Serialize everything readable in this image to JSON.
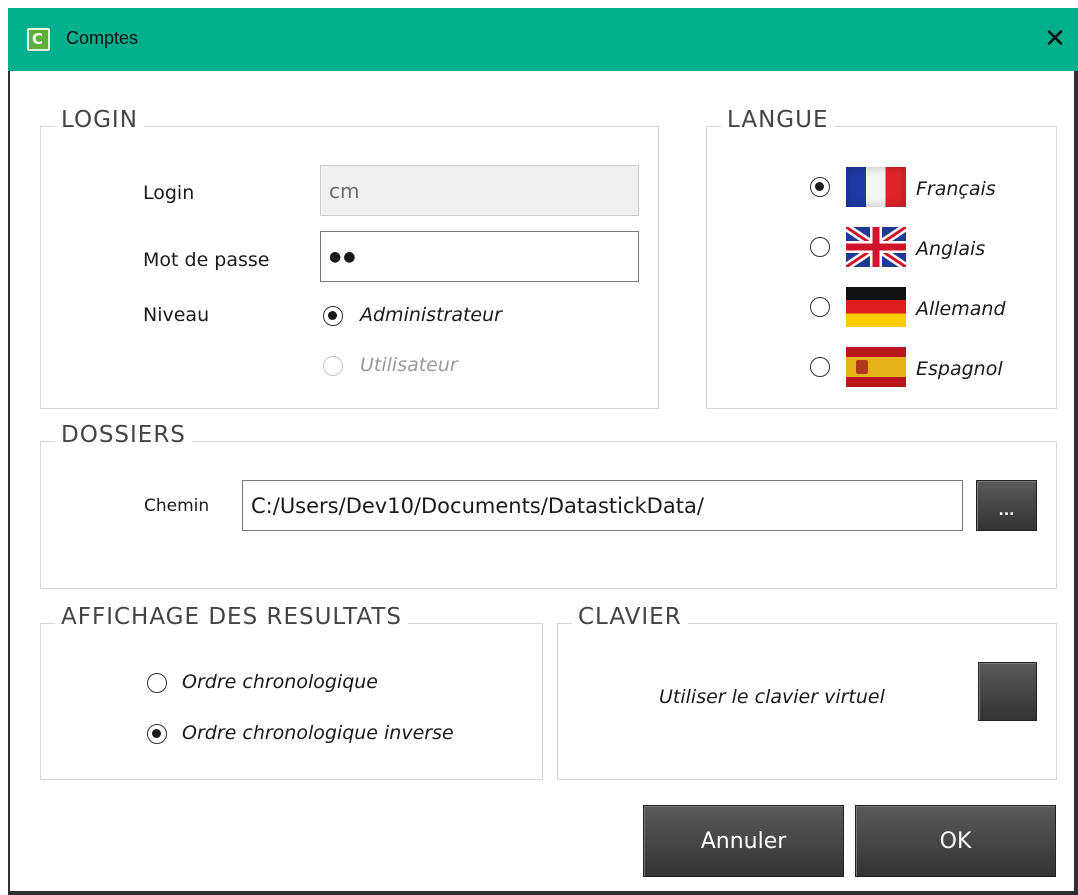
{
  "window": {
    "title": "Comptes",
    "icon": "app-logo-icon",
    "close_glyph": "✕"
  },
  "login": {
    "section_title": "LOGIN",
    "login_label": "Login",
    "login_value": "cm",
    "password_label": "Mot de passe",
    "password_value": "●●",
    "level_label": "Niveau",
    "level_options": [
      {
        "label": "Administrateur",
        "checked": true,
        "enabled": true
      },
      {
        "label": "Utilisateur",
        "checked": false,
        "enabled": false
      }
    ]
  },
  "language": {
    "section_title": "LANGUE",
    "options": [
      {
        "label": "Français",
        "flag": "flag-france-icon",
        "checked": true
      },
      {
        "label": "Anglais",
        "flag": "flag-uk-icon",
        "checked": false
      },
      {
        "label": "Allemand",
        "flag": "flag-germany-icon",
        "checked": false
      },
      {
        "label": "Espagnol",
        "flag": "flag-spain-icon",
        "checked": false
      }
    ]
  },
  "folders": {
    "section_title": "DOSSIERS",
    "path_label": "Chemin",
    "path_value": "C:/Users/Dev10/Documents/DatastickData/",
    "browse_label": "..."
  },
  "results": {
    "section_title": "AFFICHAGE DES RESULTATS",
    "options": [
      {
        "label": "Ordre chronologique",
        "checked": false
      },
      {
        "label": "Ordre chronologique inverse",
        "checked": true
      }
    ]
  },
  "keyboard": {
    "section_title": "CLAVIER",
    "virtual_label": "Utiliser le clavier virtuel",
    "enabled": false
  },
  "actions": {
    "cancel_label": "Annuler",
    "ok_label": "OK"
  },
  "colors": {
    "titlebar": "#00b08c",
    "button_dark": "#3a3a3a",
    "frame": "#2f2f2f"
  }
}
